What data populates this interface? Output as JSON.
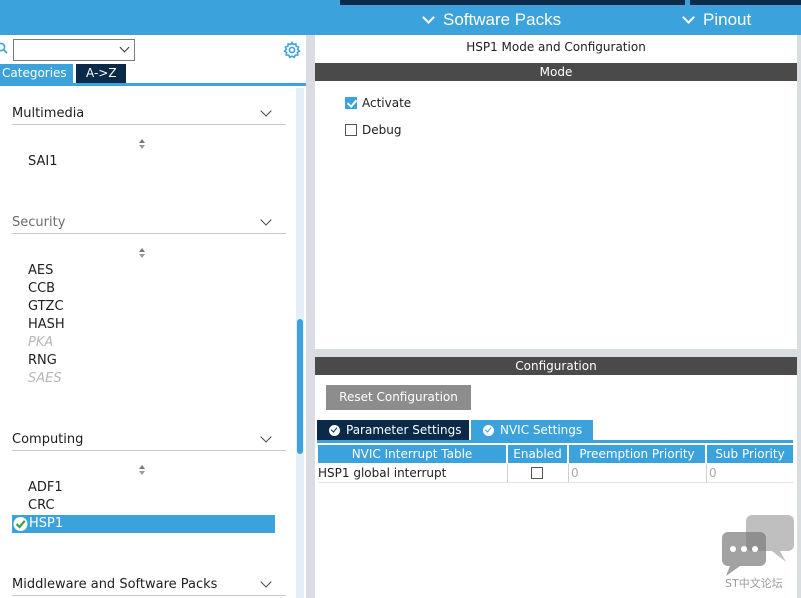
{
  "topbar": {
    "software_packs": "Software Packs",
    "pinout": "Pinout"
  },
  "left": {
    "tabs": {
      "categories": "Categories",
      "az": "A->Z"
    },
    "categories": [
      {
        "label": "Multimedia",
        "items": [
          {
            "label": "SAI1",
            "state": "normal"
          }
        ]
      },
      {
        "label": "Security",
        "items": [
          {
            "label": "AES",
            "state": "normal"
          },
          {
            "label": "CCB",
            "state": "normal"
          },
          {
            "label": "GTZC",
            "state": "normal"
          },
          {
            "label": "HASH",
            "state": "normal"
          },
          {
            "label": "PKA",
            "state": "disabled"
          },
          {
            "label": "RNG",
            "state": "normal"
          },
          {
            "label": "SAES",
            "state": "disabled"
          }
        ]
      },
      {
        "label": "Computing",
        "items": [
          {
            "label": "ADF1",
            "state": "normal"
          },
          {
            "label": "CRC",
            "state": "normal"
          },
          {
            "label": "HSP1",
            "state": "selected"
          }
        ]
      },
      {
        "label": "Middleware and Software Packs",
        "items": []
      }
    ]
  },
  "right": {
    "title": "HSP1 Mode and Configuration",
    "mode_bar": "Mode",
    "mode_options": [
      {
        "label": "Activate",
        "checked": true
      },
      {
        "label": "Debug",
        "checked": false
      }
    ],
    "config_bar": "Configuration",
    "reset_button": "Reset Configuration",
    "tabs": {
      "parameter": "Parameter Settings",
      "nvic": "NVIC Settings"
    },
    "table": {
      "headers": [
        "NVIC Interrupt Table",
        "Enabled",
        "Preemption Priority",
        "Sub Priority"
      ],
      "rows": [
        {
          "name": "HSP1 global interrupt",
          "enabled": false,
          "preemption": "0",
          "sub": "0"
        }
      ]
    }
  },
  "watermark": {
    "text": "ST中文论坛"
  },
  "colors": {
    "accent": "#3ca2dc",
    "dark": "#0b2a4a",
    "bar": "#4a4a4a"
  }
}
